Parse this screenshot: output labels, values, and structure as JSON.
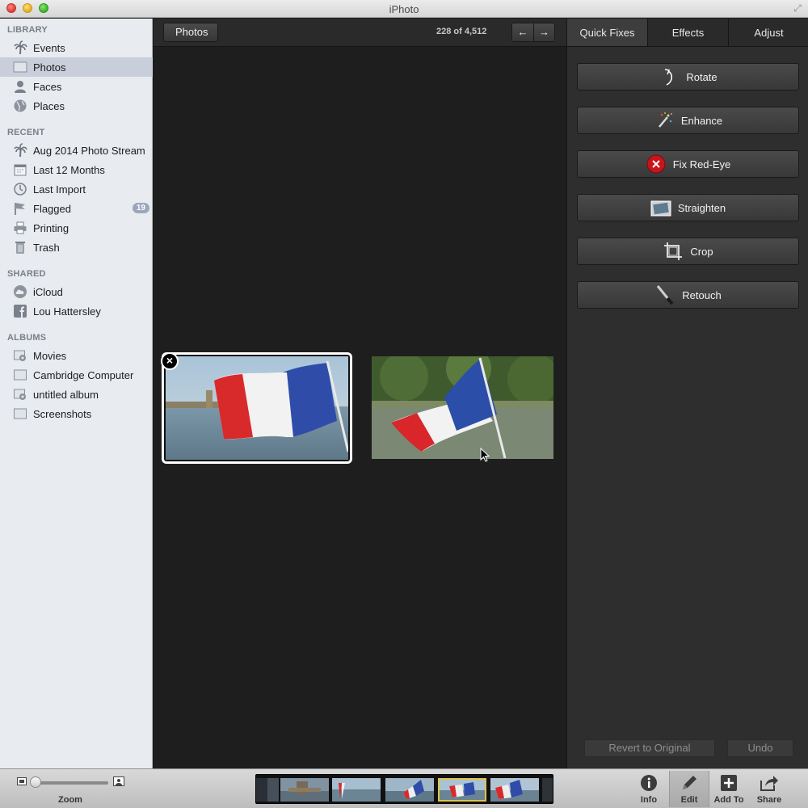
{
  "window": {
    "title": "iPhoto"
  },
  "sidebar": {
    "library_header": "LIBRARY",
    "library": [
      {
        "label": "Events",
        "icon": "palm-tree-icon"
      },
      {
        "label": "Photos",
        "icon": "photos-icon",
        "selected": true
      },
      {
        "label": "Faces",
        "icon": "person-icon"
      },
      {
        "label": "Places",
        "icon": "globe-icon"
      }
    ],
    "recent_header": "RECENT",
    "recent": [
      {
        "label": "Aug 2014 Photo Stream",
        "icon": "palm-tree-icon"
      },
      {
        "label": "Last 12 Months",
        "icon": "calendar-icon"
      },
      {
        "label": "Last Import",
        "icon": "clock-icon"
      },
      {
        "label": "Flagged",
        "icon": "flag-icon",
        "badge": "19"
      },
      {
        "label": "Printing",
        "icon": "printer-icon"
      },
      {
        "label": "Trash",
        "icon": "trash-icon"
      }
    ],
    "shared_header": "SHARED",
    "shared": [
      {
        "label": "iCloud",
        "icon": "cloud-icon"
      },
      {
        "label": "Lou Hattersley",
        "icon": "facebook-icon"
      }
    ],
    "albums_header": "ALBUMS",
    "albums": [
      {
        "label": "Movies",
        "icon": "smart-album-icon"
      },
      {
        "label": "Cambridge Computer",
        "icon": "album-icon"
      },
      {
        "label": "untitled album",
        "icon": "smart-album-icon"
      },
      {
        "label": "Screenshots",
        "icon": "album-icon"
      }
    ]
  },
  "viewer": {
    "back_label": "Photos",
    "counter": "228 of 4,512",
    "prev_icon": "←",
    "next_icon": "→"
  },
  "panel": {
    "tabs": [
      "Quick Fixes",
      "Effects",
      "Adjust"
    ],
    "active_tab": "Quick Fixes",
    "buttons": [
      {
        "label": "Rotate",
        "icon": "rotate-icon"
      },
      {
        "label": "Enhance",
        "icon": "magic-wand-icon"
      },
      {
        "label": "Fix Red-Eye",
        "icon": "red-eye-icon"
      },
      {
        "label": "Straighten",
        "icon": "straighten-icon"
      },
      {
        "label": "Crop",
        "icon": "crop-icon"
      },
      {
        "label": "Retouch",
        "icon": "brush-icon"
      }
    ],
    "revert_label": "Revert to Original",
    "undo_label": "Undo"
  },
  "bottombar": {
    "zoom_label": "Zoom",
    "zoom_level": 0.0,
    "tools": [
      {
        "label": "Info",
        "icon": "info-icon"
      },
      {
        "label": "Edit",
        "icon": "pencil-icon",
        "active": true
      },
      {
        "label": "Add To",
        "icon": "plus-icon"
      },
      {
        "label": "Share",
        "icon": "share-icon"
      }
    ]
  }
}
